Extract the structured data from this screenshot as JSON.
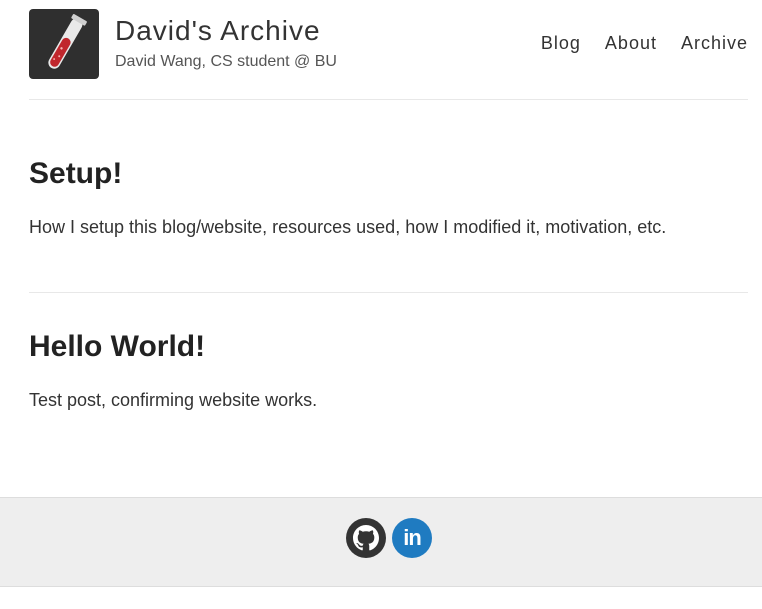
{
  "header": {
    "title": "David's Archive",
    "subtitle": "David Wang, CS student @ BU",
    "nav": [
      "Blog",
      "About",
      "Archive"
    ]
  },
  "posts": [
    {
      "title": "Setup!",
      "excerpt": "How I setup this blog/website, resources used, how I modified it, motivation, etc."
    },
    {
      "title": "Hello World!",
      "excerpt": "Test post, confirming website works."
    }
  ],
  "footer": {
    "social": [
      {
        "icon": "github-icon",
        "color": "#333333"
      },
      {
        "icon": "linkedin-icon",
        "color": "#1f7bc1",
        "text": "in"
      }
    ]
  },
  "colors": {
    "accent_linkedin": "#1f7bc1",
    "footer_bg": "#eeeeee",
    "logo_bg": "#2f2f2f",
    "test_tube_liquid": "#c0272d"
  }
}
